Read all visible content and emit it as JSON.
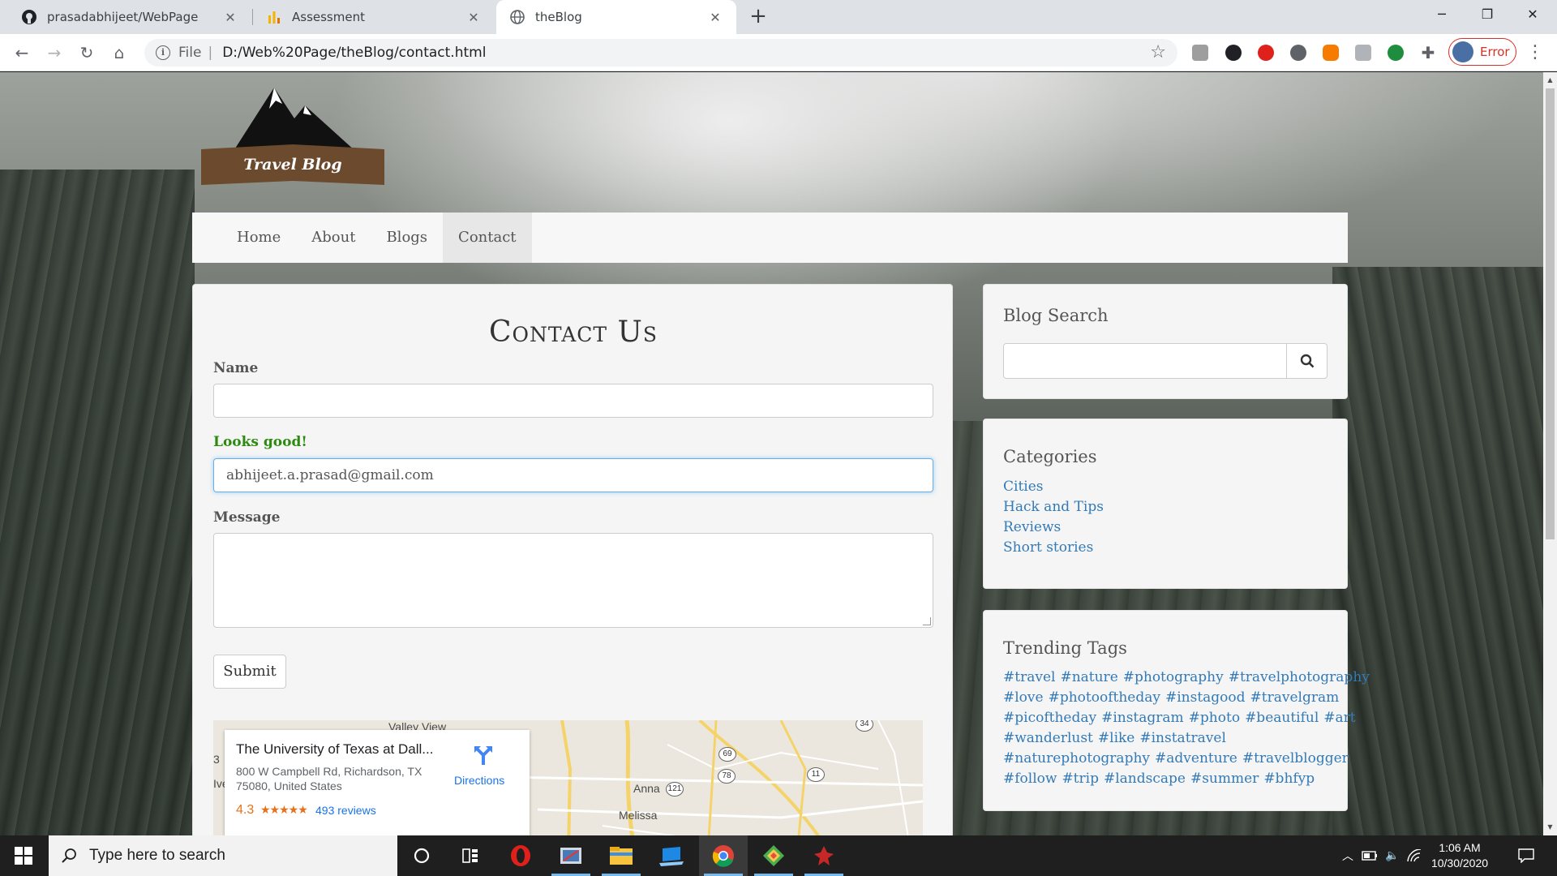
{
  "browser": {
    "tabs": [
      {
        "title": "prasadabhijeet/WebPage",
        "icon": "github-icon"
      },
      {
        "title": "Assessment",
        "icon": "chart-icon"
      },
      {
        "title": "theBlog",
        "icon": "globe-icon"
      }
    ],
    "address": {
      "scheme": "File",
      "url": "D:/Web%20Page/theBlog/contact.html"
    },
    "profile_label": "Error"
  },
  "site": {
    "logo_text": "Travel Blog",
    "nav": [
      "Home",
      "About",
      "Blogs",
      "Contact"
    ],
    "active_nav": "Contact"
  },
  "contact": {
    "title": "Contact Us",
    "name_label": "Name",
    "name_value": "",
    "email_label": "Looks good!",
    "email_value": "abhijeet.a.prasad@gmail.com",
    "message_label": "Message",
    "message_value": "",
    "submit_label": "Submit"
  },
  "map": {
    "place_name": "The University of Texas at Dall...",
    "address_line1": "800 W Campbell Rd, Richardson, TX",
    "address_line2": "75080, United States",
    "rating": "4.3",
    "stars": "★★★★★",
    "reviews": "493 reviews",
    "directions_label": "Directions",
    "labels": [
      "Valley View",
      "Anna",
      "Melissa"
    ],
    "shields": [
      "69",
      "78",
      "121",
      "11",
      "34"
    ],
    "edge_letters": [
      "3",
      "Ive"
    ]
  },
  "sidebar": {
    "search_title": "Blog Search",
    "categories_title": "Categories",
    "categories": [
      "Cities",
      "Hack and Tips",
      "Reviews",
      "Short stories"
    ],
    "tags_title": "Trending Tags",
    "tags": [
      "#travel",
      "#nature",
      "#photography",
      "#travelphotography",
      "#love",
      "#photooftheday",
      "#instagood",
      "#travelgram",
      "#picoftheday",
      "#instagram",
      "#photo",
      "#beautiful",
      "#art",
      "#wanderlust",
      "#like",
      "#instatravel",
      "#naturephotography",
      "#adventure",
      "#travelblogger",
      "#follow",
      "#trip",
      "#landscape",
      "#summer",
      "#bhfyp"
    ]
  },
  "taskbar": {
    "search_placeholder": "Type here to search",
    "time": "1:06 AM",
    "date": "10/30/2020"
  },
  "colors": {
    "link": "#337ab7",
    "valid": "#2b8a0f",
    "focus": "#66afe9",
    "profile_error": "#d93025"
  }
}
